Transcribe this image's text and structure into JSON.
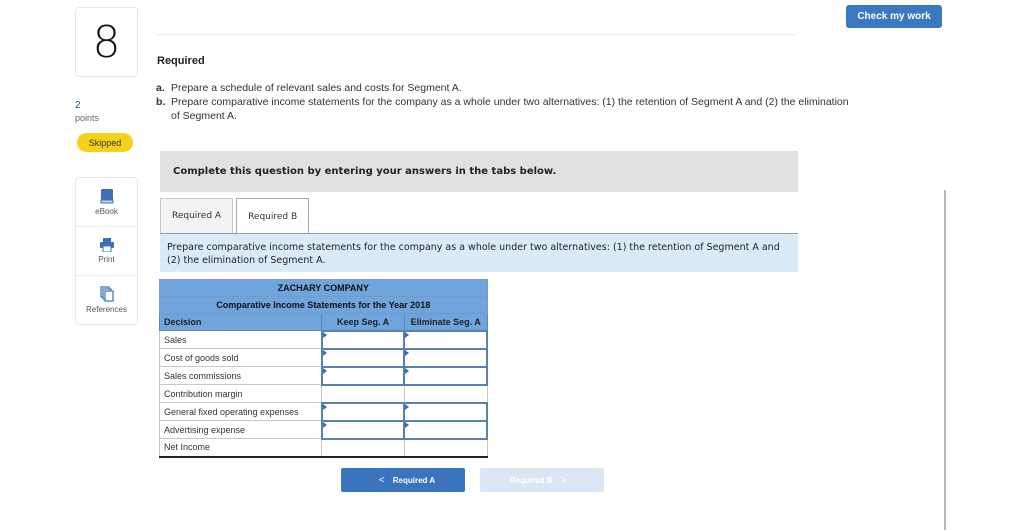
{
  "question": {
    "number": "8",
    "points_value": "2",
    "points_label": "points",
    "status_badge": "Skipped"
  },
  "tools": [
    {
      "label": "eBook",
      "icon": "book-icon"
    },
    {
      "label": "Print",
      "icon": "printer-icon"
    },
    {
      "label": "References",
      "icon": "references-icon"
    }
  ],
  "header": {
    "check_button": "Check my work"
  },
  "required": {
    "title": "Required",
    "items": [
      {
        "letter": "a.",
        "text": "Prepare a schedule of relevant sales and costs for Segment A."
      },
      {
        "letter": "b.",
        "text": "Prepare comparative income statements for the company as a whole under two alternatives: (1) the retention of Segment A and (2) the elimination of Segment A."
      }
    ]
  },
  "instruction": "Complete this question by entering your answers in the tabs below.",
  "tabs": [
    {
      "label": "Required A",
      "active": false
    },
    {
      "label": "Required B",
      "active": true
    }
  ],
  "tab_description": "Prepare comparative income statements for the company as a whole under two alternatives: (1) the retention of Segment A and (2) the elimination of Segment A.",
  "statement": {
    "company": "ZACHARY COMPANY",
    "title": "Comparative Income Statements for the Year 2018",
    "columns": [
      "Decision",
      "Keep Seg. A",
      "Eliminate Seg. A"
    ],
    "rows": [
      {
        "label": "Sales",
        "keep": "",
        "eliminate": "",
        "input": true
      },
      {
        "label": "Cost of goods sold",
        "keep": "",
        "eliminate": "",
        "input": true
      },
      {
        "label": "Sales commissions",
        "keep": "",
        "eliminate": "",
        "input": true
      },
      {
        "label": "Contribution margin",
        "keep": "",
        "eliminate": "",
        "input": false
      },
      {
        "label": "General fixed operating expenses",
        "keep": "",
        "eliminate": "",
        "input": true
      },
      {
        "label": "Advertising expense",
        "keep": "",
        "eliminate": "",
        "input": true
      },
      {
        "label": "Net Income",
        "keep": "",
        "eliminate": "",
        "input": false
      }
    ]
  },
  "navigation": {
    "prev_label": "Required A",
    "next_label": "Required B",
    "prev_chevron": "<",
    "next_chevron": ">"
  },
  "colors": {
    "accent": "#3a78c3",
    "badge": "#f6d11c",
    "table_header": "#70a4dc",
    "description_bg": "#dbeaf7"
  }
}
